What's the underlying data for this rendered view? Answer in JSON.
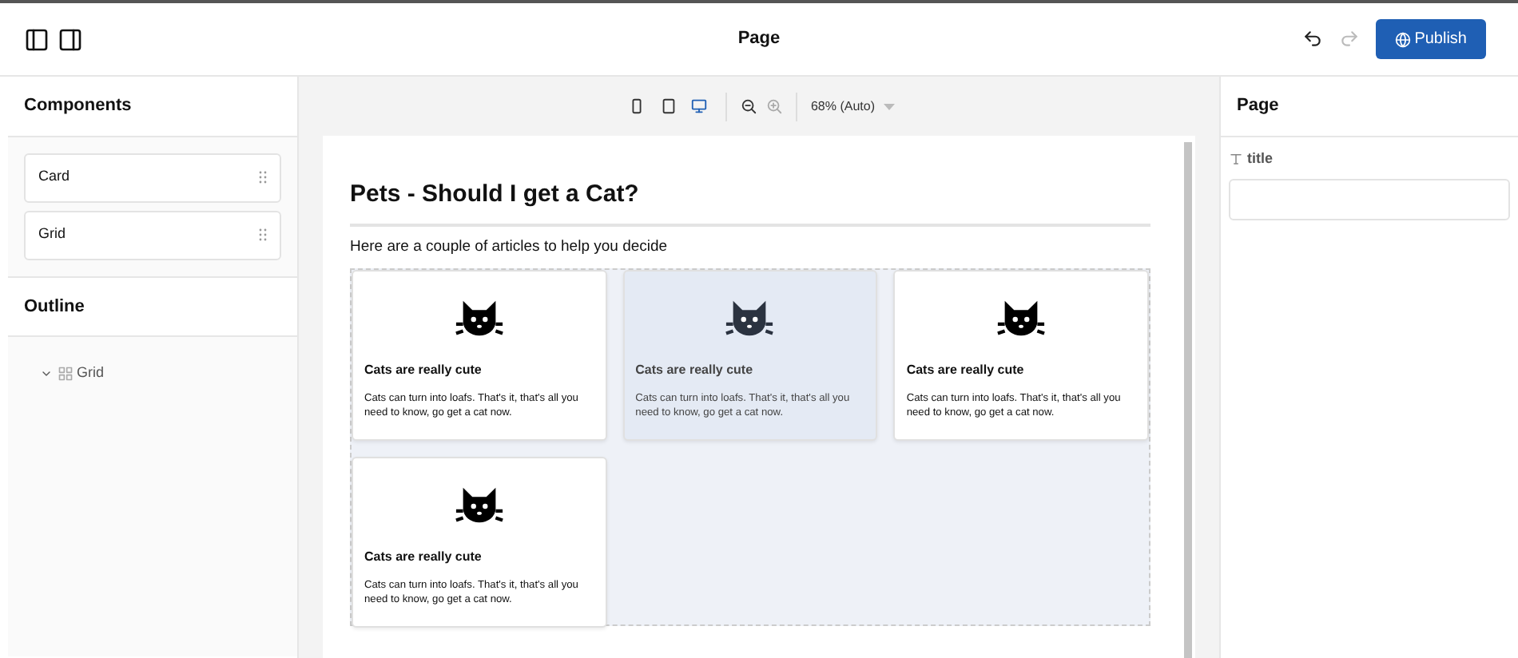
{
  "header": {
    "title": "Page",
    "publish": "Publish",
    "undo_disabled": false,
    "redo_disabled": true
  },
  "components": {
    "title": "Components",
    "items": [
      "Card",
      "Grid"
    ]
  },
  "outline": {
    "title": "Outline",
    "items": [
      {
        "label": "Grid",
        "expanded": true
      }
    ]
  },
  "toolbar": {
    "devices": [
      {
        "kind": "phone",
        "selected": false
      },
      {
        "kind": "tablet",
        "selected": false
      },
      {
        "kind": "desktop",
        "selected": true
      }
    ],
    "zoom": "68% (Auto)"
  },
  "canvas": {
    "heading": "Pets - Should I get a Cat?",
    "intro": "Here are a couple of articles to help you decide",
    "cards": [
      {
        "title": "Cats are really cute",
        "text": "Cats can turn into loafs. That's it, that's all you need to know, go get a cat now.",
        "hovered": false
      },
      {
        "title": "Cats are really cute",
        "text": "Cats can turn into loafs. That's it, that's all you need to know, go get a cat now.",
        "hovered": true
      },
      {
        "title": "Cats are really cute",
        "text": "Cats can turn into loafs. That's it, that's all you need to know, go get a cat now.",
        "hovered": false
      },
      {
        "title": "Cats are really cute",
        "text": "Cats can turn into loafs. That's it, that's all you need to know, go get a cat now.",
        "hovered": false
      }
    ]
  },
  "properties": {
    "title": "Page",
    "fields": [
      {
        "label": "title"
      }
    ]
  }
}
